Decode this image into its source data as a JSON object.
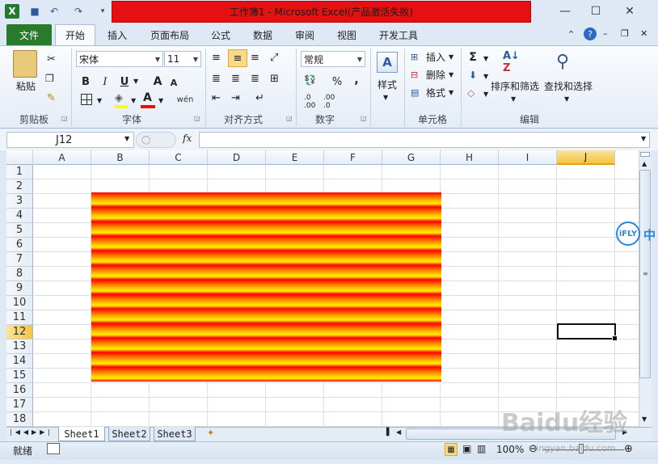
{
  "window": {
    "title": "工作簿1 - Microsoft Excel(产品激活失败)",
    "minimize_glyph": "—",
    "maximize_glyph": "☐",
    "close_glyph": "✕"
  },
  "ribbon_tabs": [
    "文件",
    "开始",
    "插入",
    "页面布局",
    "公式",
    "数据",
    "审阅",
    "视图",
    "开发工具"
  ],
  "ribbon": {
    "clipboard": {
      "paste": "粘贴",
      "label": "剪贴板"
    },
    "font": {
      "font_name": "宋体",
      "font_size": "11",
      "label": "字体",
      "bold": "B",
      "italic": "I",
      "underline": "U",
      "grow": "A",
      "shrink": "A",
      "phonetic": "wén"
    },
    "alignment": {
      "label": "对齐方式"
    },
    "number": {
      "format": "常规",
      "percent": "%",
      "comma": ",",
      "label": "数字"
    },
    "styles": {
      "label": "样式"
    },
    "cells": {
      "insert": "插入",
      "delete": "删除",
      "format": "格式",
      "label": "单元格"
    },
    "editing": {
      "sum": "Σ",
      "sort_filter": "排序和筛选",
      "find_select": "查找和选择",
      "label": "编辑"
    }
  },
  "formula_bar": {
    "name_box": "J12",
    "fx": "fx",
    "value": ""
  },
  "grid": {
    "columns": [
      "A",
      "B",
      "C",
      "D",
      "E",
      "F",
      "G",
      "H",
      "I",
      "J"
    ],
    "rows": [
      "1",
      "2",
      "3",
      "4",
      "5",
      "6",
      "7",
      "8",
      "9",
      "10",
      "11",
      "12",
      "13",
      "14",
      "15",
      "16",
      "17",
      "18"
    ],
    "selected_column": "J",
    "selected_row": "12"
  },
  "sheets": [
    "Sheet1",
    "Sheet2",
    "Sheet3"
  ],
  "status": {
    "ready": "就绪",
    "zoom": "100%"
  },
  "overlay": {
    "ifly": "iFLY",
    "zh": "中",
    "watermark": "Baidu经验",
    "watermark_url": "jingyan.baidu.com"
  }
}
